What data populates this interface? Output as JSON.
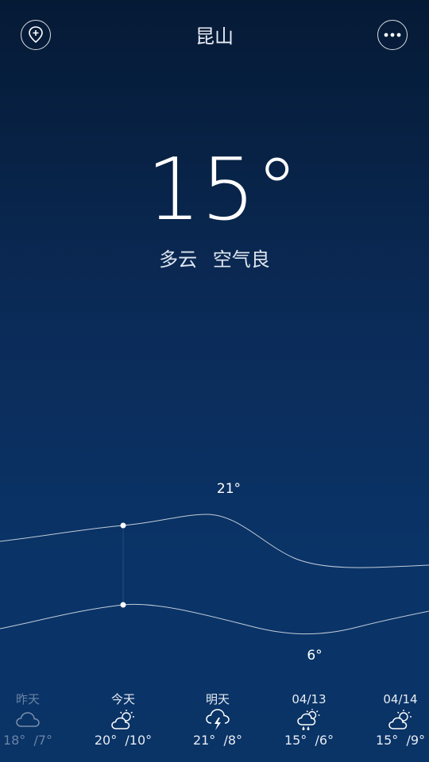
{
  "header": {
    "city": "昆山",
    "add_icon": "add-location-icon",
    "more_icon": "more-dots-icon"
  },
  "current": {
    "temperature": "15°",
    "condition": "多云",
    "air_quality": "空气良"
  },
  "chart_data": {
    "type": "line",
    "high_label": "21°",
    "low_label": "6°",
    "series": [
      {
        "values": [
          18,
          20,
          21,
          15,
          15
        ]
      },
      {
        "values": [
          7,
          10,
          8,
          6,
          9
        ]
      }
    ],
    "categories": [
      "昨天",
      "今天",
      "明天",
      "04/13",
      "04/14"
    ],
    "grid": false
  },
  "forecast": [
    {
      "label": "昨天",
      "icon": "cloud-icon",
      "high": "18°",
      "low": "/7°"
    },
    {
      "label": "今天",
      "icon": "partly-cloudy-icon",
      "high": "20°",
      "low": "/10°"
    },
    {
      "label": "明天",
      "icon": "thunderstorm-icon",
      "high": "21°",
      "low": "/8°"
    },
    {
      "label": "04/13",
      "icon": "sun-rain-icon",
      "high": "15°",
      "low": "/6°"
    },
    {
      "label": "04/14",
      "icon": "partly-cloudy-icon",
      "high": "15°",
      "low": "/9°"
    }
  ],
  "colors": {
    "bg_top": "#051a35",
    "bg_bottom": "#0a3366",
    "text": "#ffffff"
  }
}
